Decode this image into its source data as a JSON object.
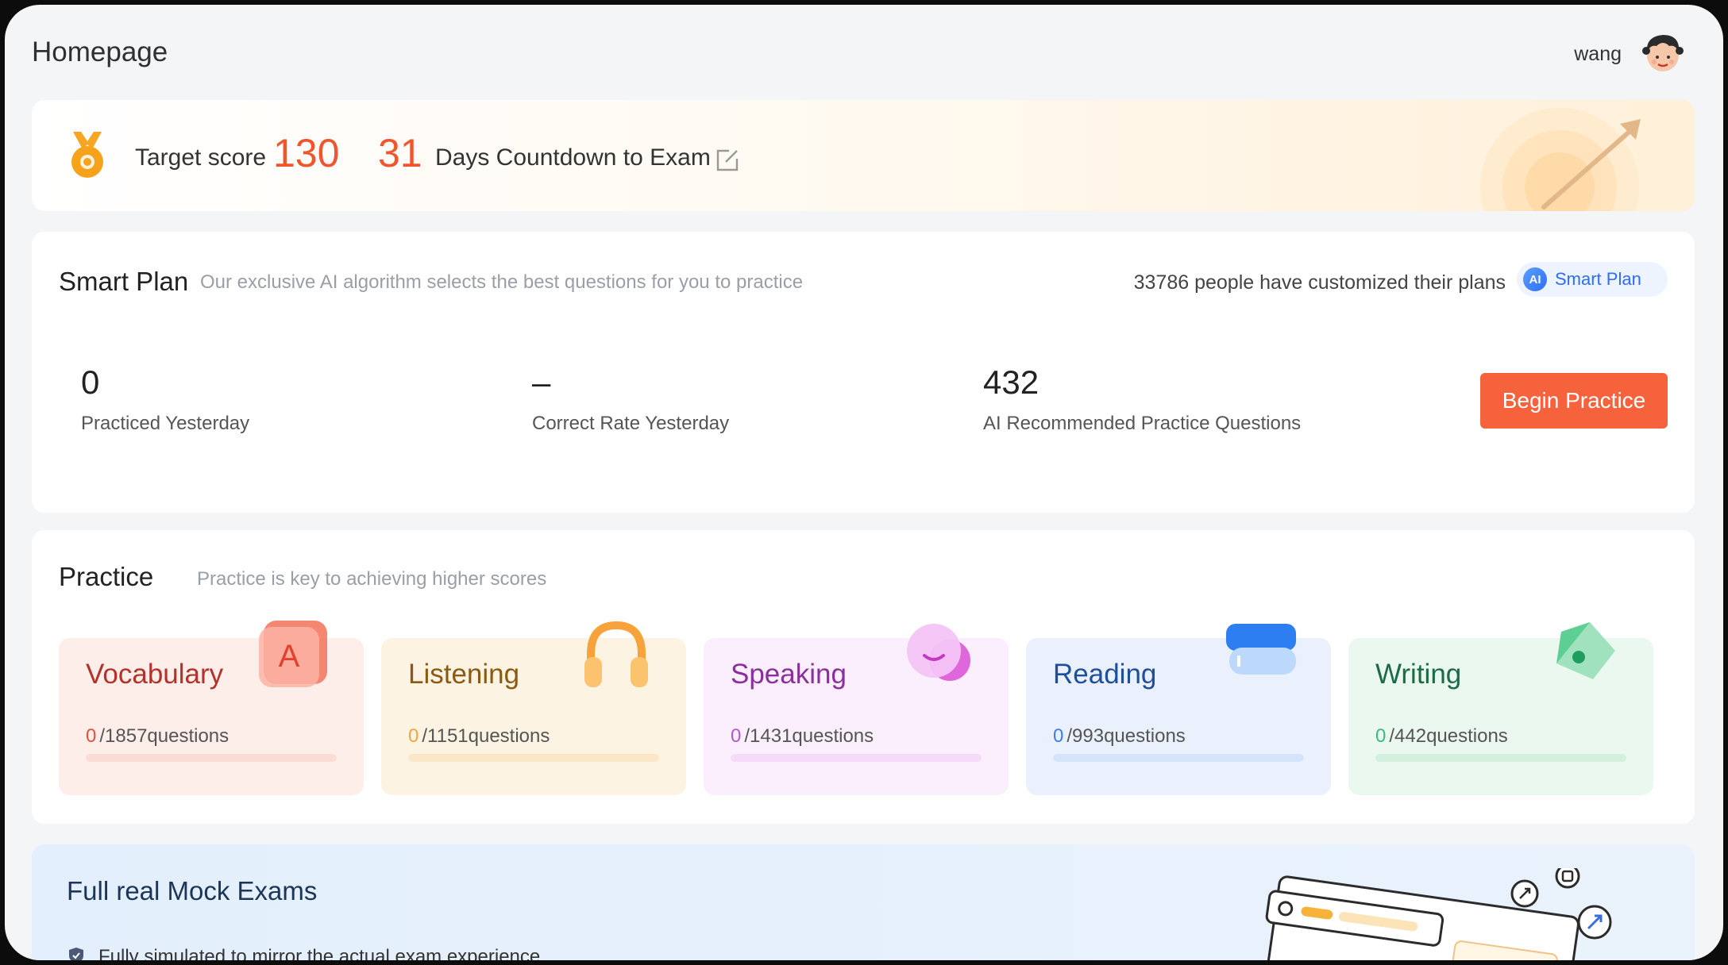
{
  "header": {
    "title": "Homepage",
    "user_name": "wang"
  },
  "target": {
    "label": "Target score",
    "score": "130",
    "days": "31",
    "days_label": "Days Countdown to Exam"
  },
  "smart_plan": {
    "title": "Smart Plan",
    "subtitle": "Our exclusive AI algorithm selects the best questions for you to practice",
    "count_text": "33786 people have customized their plans",
    "badge_icon": "AI",
    "badge_label": "Smart Plan",
    "stats": [
      {
        "value": "0",
        "label": "Practiced Yesterday"
      },
      {
        "value": "–",
        "label": "Correct Rate Yesterday"
      },
      {
        "value": "432",
        "label": "AI Recommended Practice Questions"
      }
    ],
    "button": "Begin Practice"
  },
  "practice": {
    "title": "Practice",
    "subtitle": "Practice is key to achieving higher scores",
    "tiles": [
      {
        "name": "Vocabulary",
        "done": "0",
        "total": "/1857questions",
        "progress": 0,
        "color": "#b3322a",
        "num_color": "#e0533b",
        "bg": "#fdeeea",
        "bar": "#fbdcd5",
        "icon": "letter-a-icon"
      },
      {
        "name": "Listening",
        "done": "0",
        "total": "/1151questions",
        "progress": 0,
        "color": "#8a5a12",
        "num_color": "#f0a53a",
        "bg": "#fdf3e3",
        "bar": "#fbe7c8",
        "icon": "headphones-icon"
      },
      {
        "name": "Speaking",
        "done": "0",
        "total": "/1431questions",
        "progress": 0,
        "color": "#8a2f9e",
        "num_color": "#b557d0",
        "bg": "#fbeefd",
        "bar": "#f4dcf8",
        "icon": "chat-bubble-icon"
      },
      {
        "name": "Reading",
        "done": "0",
        "total": "/993questions",
        "progress": 0,
        "color": "#1f4f9c",
        "num_color": "#3f7de8",
        "bg": "#eaf1fd",
        "bar": "#d6e4fb",
        "icon": "book-icon"
      },
      {
        "name": "Writing",
        "done": "0",
        "total": "/442questions",
        "progress": 0,
        "color": "#1c6b45",
        "num_color": "#3cbb7a",
        "bg": "#eaf8ef",
        "bar": "#d3f0de",
        "icon": "pen-nib-icon"
      }
    ]
  },
  "mock": {
    "title": "Full real Mock Exams",
    "subtitle": "Fully simulated to mirror the actual exam experience"
  }
}
